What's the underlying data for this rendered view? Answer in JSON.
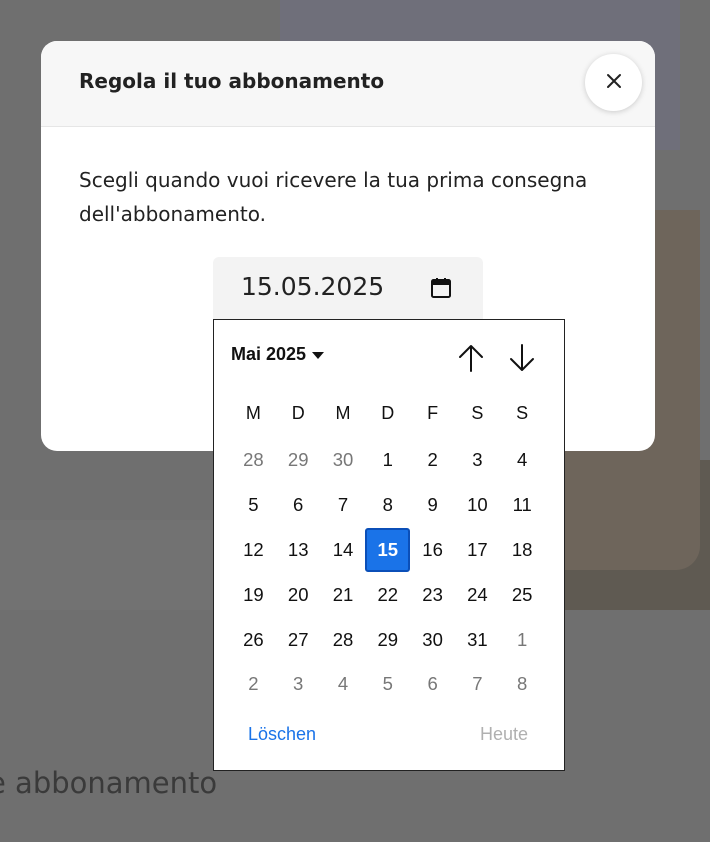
{
  "background": {
    "heading": "e abbonamento"
  },
  "modal": {
    "title": "Regola il tuo abbonamento",
    "description": "Scegli quando vuoi ricevere la tua prima consegna dell'abbonamento.",
    "date_input": {
      "value": "15.05.2025"
    }
  },
  "picker": {
    "month_label": "Mai 2025",
    "weekdays": [
      "M",
      "D",
      "M",
      "D",
      "F",
      "S",
      "S"
    ],
    "weeks": [
      [
        {
          "d": "28",
          "other": true
        },
        {
          "d": "29",
          "other": true
        },
        {
          "d": "30",
          "other": true
        },
        {
          "d": "1"
        },
        {
          "d": "2"
        },
        {
          "d": "3"
        },
        {
          "d": "4"
        }
      ],
      [
        {
          "d": "5"
        },
        {
          "d": "6"
        },
        {
          "d": "7"
        },
        {
          "d": "8"
        },
        {
          "d": "9"
        },
        {
          "d": "10"
        },
        {
          "d": "11"
        }
      ],
      [
        {
          "d": "12"
        },
        {
          "d": "13"
        },
        {
          "d": "14"
        },
        {
          "d": "15",
          "selected": true
        },
        {
          "d": "16"
        },
        {
          "d": "17"
        },
        {
          "d": "18"
        }
      ],
      [
        {
          "d": "19"
        },
        {
          "d": "20"
        },
        {
          "d": "21"
        },
        {
          "d": "22"
        },
        {
          "d": "23"
        },
        {
          "d": "24"
        },
        {
          "d": "25"
        }
      ],
      [
        {
          "d": "26"
        },
        {
          "d": "27"
        },
        {
          "d": "28"
        },
        {
          "d": "29"
        },
        {
          "d": "30"
        },
        {
          "d": "31"
        },
        {
          "d": "1",
          "other": true
        }
      ],
      [
        {
          "d": "2",
          "other": true
        },
        {
          "d": "3",
          "other": true
        },
        {
          "d": "4",
          "other": true
        },
        {
          "d": "5",
          "other": true
        },
        {
          "d": "6",
          "other": true
        },
        {
          "d": "7",
          "other": true
        },
        {
          "d": "8",
          "other": true
        }
      ]
    ],
    "clear_label": "Löschen",
    "today_label": "Heute"
  },
  "icons": {
    "close": "close-icon",
    "calendar": "calendar-icon",
    "prev": "arrow-up-icon",
    "next": "arrow-down-icon",
    "month_dropdown": "caret-down-icon"
  },
  "colors": {
    "accent": "#1a73e8",
    "overlay": "#6f6f6f",
    "muted_text": "#777777",
    "disabled_text": "#b0b0b0"
  }
}
